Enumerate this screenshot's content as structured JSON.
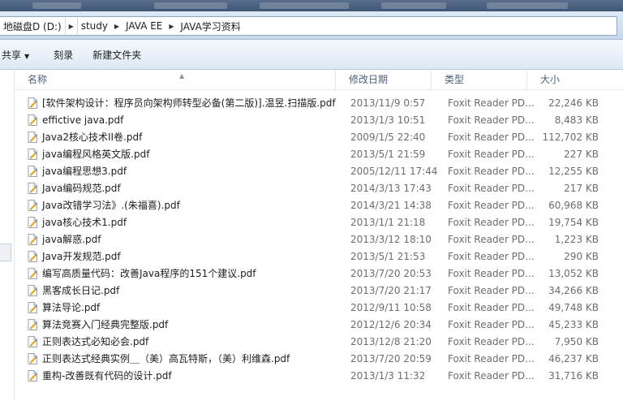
{
  "address": {
    "crumbs": [
      {
        "label": "地磁盘D (D:)"
      },
      {
        "label": "study"
      },
      {
        "label": "JAVA EE"
      },
      {
        "label": "JAVA学习资料"
      }
    ]
  },
  "toolbar": {
    "share_label": "共享",
    "burn_label": "刻录",
    "new_folder_label": "新建文件夹"
  },
  "columns": {
    "name": "名称",
    "date": "修改日期",
    "type": "类型",
    "size": "大小"
  },
  "colors": {
    "pdf_icon_accent": "#e8a11c",
    "pdf_icon_pencil": "#3b6fc7"
  },
  "files": [
    {
      "name": "[软件架构设计：程序员向架构师转型必备(第二版)].温昱.扫描版.pdf",
      "date": "2013/11/9 0:57",
      "type": "Foxit Reader PD...",
      "size": "22,246 KB"
    },
    {
      "name": "effictive java.pdf",
      "date": "2013/1/3 10:51",
      "type": "Foxit Reader PD...",
      "size": "8,483 KB"
    },
    {
      "name": "Java2核心技术II卷.pdf",
      "date": "2009/1/5 22:40",
      "type": "Foxit Reader PD...",
      "size": "112,702 KB"
    },
    {
      "name": "java编程风格英文版.pdf",
      "date": "2013/5/1 21:59",
      "type": "Foxit Reader PD...",
      "size": "227 KB"
    },
    {
      "name": "java编程思想3.pdf",
      "date": "2005/12/11 17:44",
      "type": "Foxit Reader PD...",
      "size": "12,255 KB"
    },
    {
      "name": "Java编码规范.pdf",
      "date": "2014/3/13 17:43",
      "type": "Foxit Reader PD...",
      "size": "217 KB"
    },
    {
      "name": "Java改错学习法》.(朱福喜).pdf",
      "date": "2014/3/21 14:38",
      "type": "Foxit Reader PD...",
      "size": "60,968 KB"
    },
    {
      "name": "java核心技术1.pdf",
      "date": "2013/1/1 21:18",
      "type": "Foxit Reader PD...",
      "size": "19,754 KB"
    },
    {
      "name": "java解惑.pdf",
      "date": "2013/3/12 18:10",
      "type": "Foxit Reader PD...",
      "size": "1,223 KB"
    },
    {
      "name": "Java开发规范.pdf",
      "date": "2013/5/1 21:53",
      "type": "Foxit Reader PD...",
      "size": "290 KB"
    },
    {
      "name": "编写高质量代码：改善Java程序的151个建议.pdf",
      "date": "2013/7/20 20:53",
      "type": "Foxit Reader PD...",
      "size": "13,052 KB"
    },
    {
      "name": "黑客成长日记.pdf",
      "date": "2013/7/20 21:17",
      "type": "Foxit Reader PD...",
      "size": "34,266 KB"
    },
    {
      "name": "算法导论.pdf",
      "date": "2012/9/11 10:58",
      "type": "Foxit Reader PD...",
      "size": "49,748 KB"
    },
    {
      "name": "算法竞赛入门经典完整版.pdf",
      "date": "2012/12/6 20:34",
      "type": "Foxit Reader PD...",
      "size": "45,233 KB"
    },
    {
      "name": "正则表达式必知必会.pdf",
      "date": "2013/12/8 21:20",
      "type": "Foxit Reader PD...",
      "size": "7,950 KB"
    },
    {
      "name": "正则表达式经典实例＿（美）高瓦特斯，（美）利维森.pdf",
      "date": "2013/7/20 20:59",
      "type": "Foxit Reader PD...",
      "size": "46,237 KB"
    },
    {
      "name": "重构-改善既有代码的设计.pdf",
      "date": "2013/1/3 11:32",
      "type": "Foxit Reader PD...",
      "size": "31,716 KB"
    }
  ]
}
